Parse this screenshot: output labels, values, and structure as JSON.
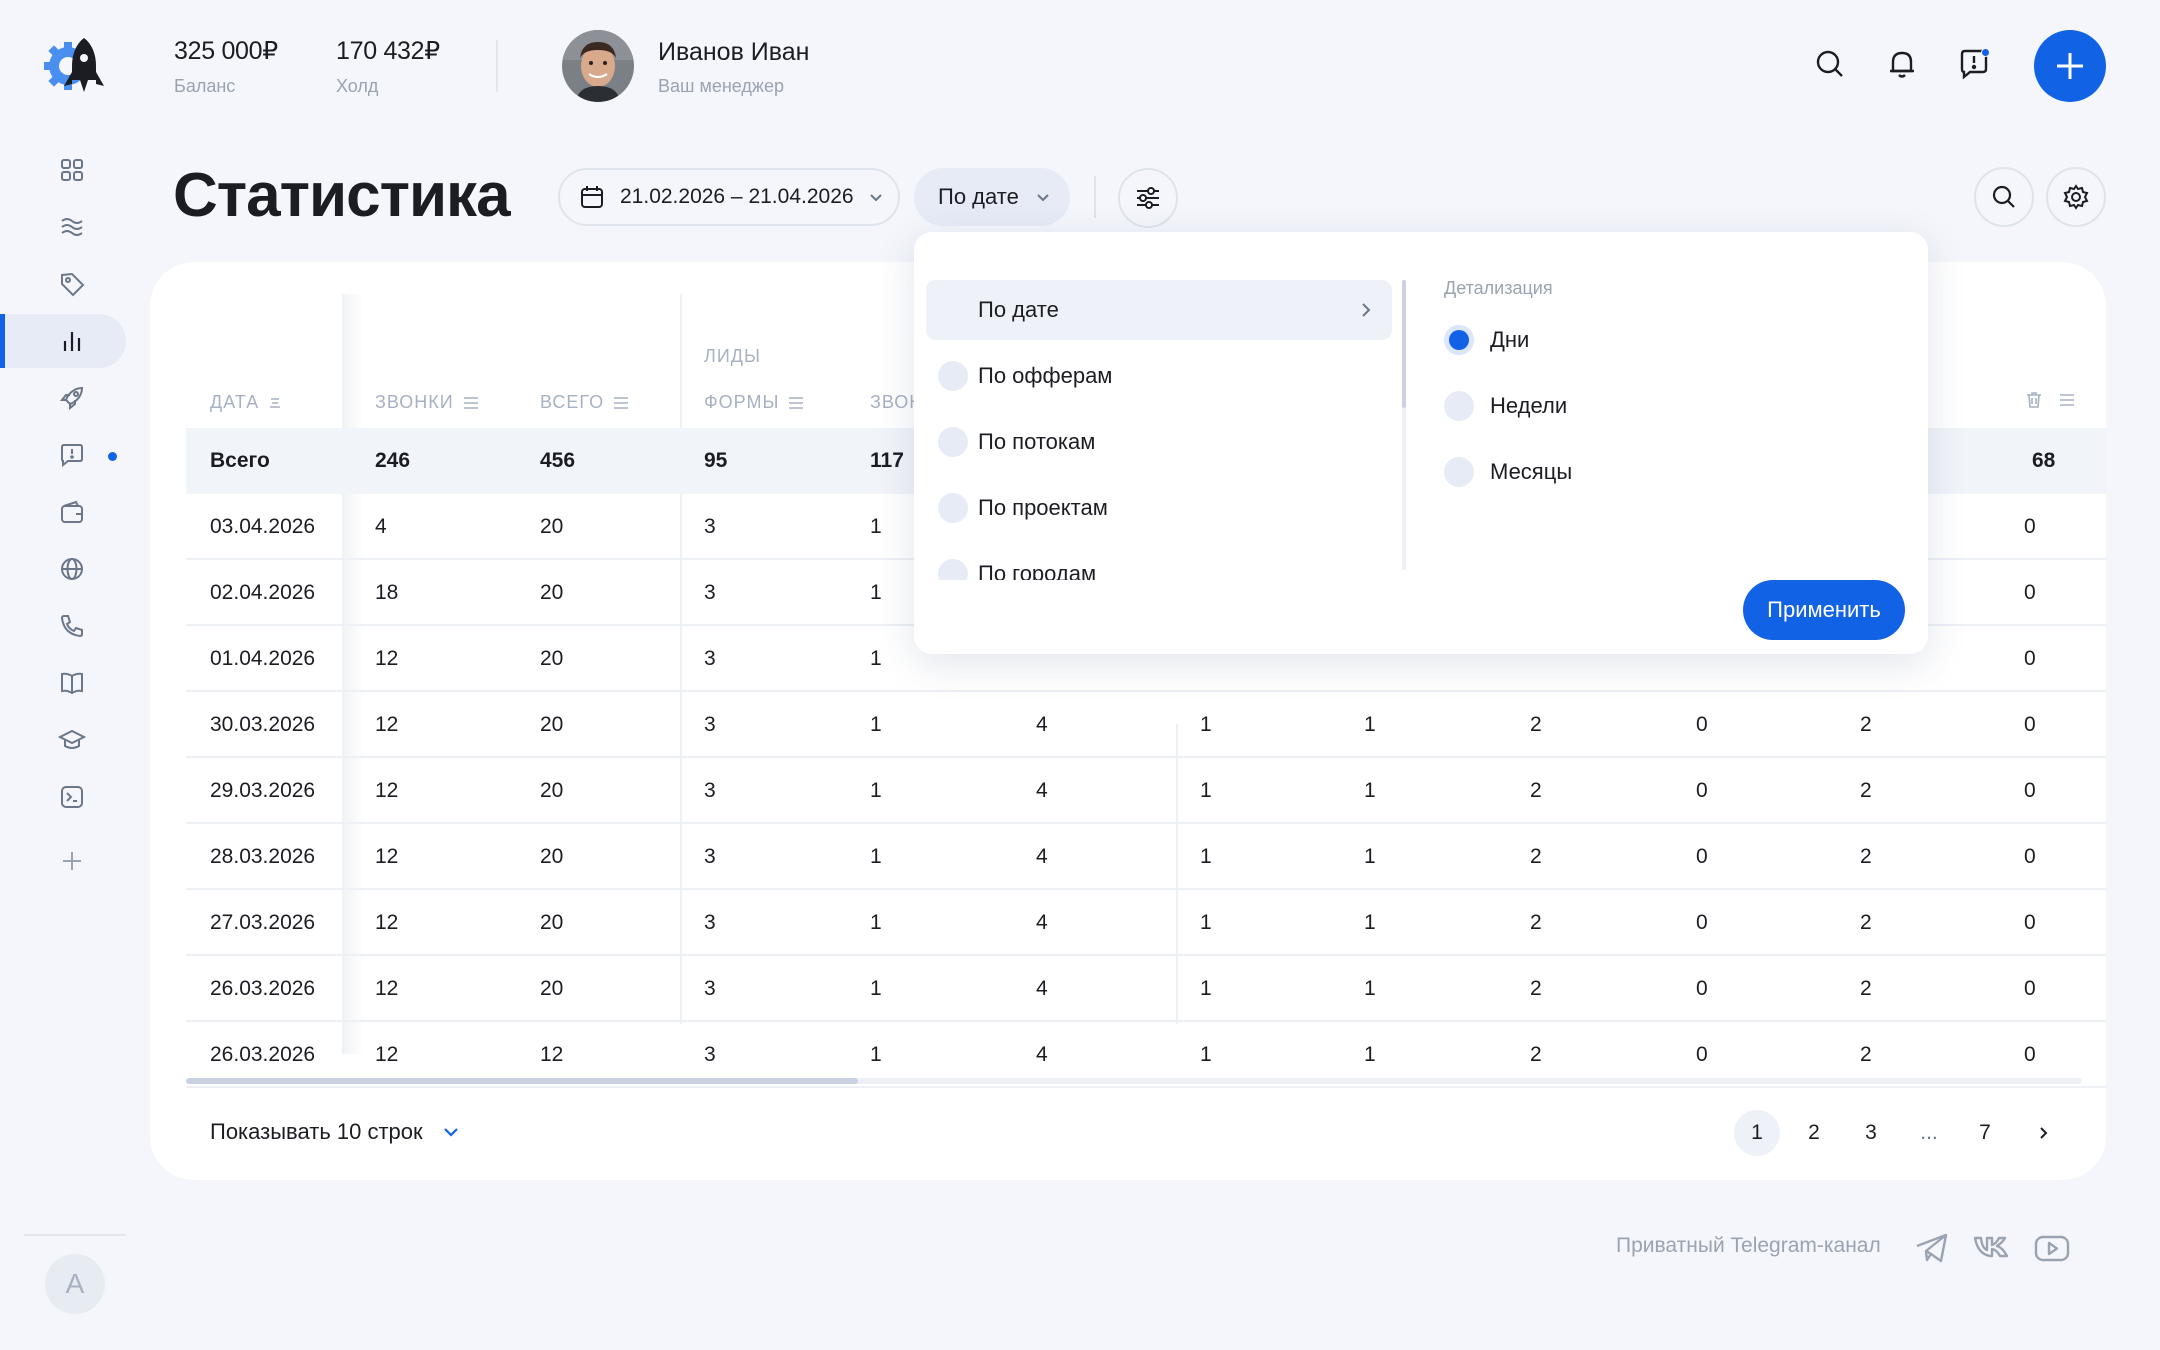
{
  "top": {
    "balances": [
      {
        "value": "325 000₽",
        "label": "Баланс"
      },
      {
        "value": "170 432₽",
        "label": "Холд"
      }
    ],
    "manager": {
      "name": "Иванов Иван",
      "role": "Ваш менеджер"
    }
  },
  "sidebar": {
    "items": [
      "grid-icon",
      "waves-icon",
      "tag-icon",
      "chart-icon",
      "rocket-icon",
      "chat-alert-icon",
      "wallet-icon",
      "globe-icon",
      "phone-icon",
      "book-icon",
      "graduation-icon",
      "terminal-icon",
      "plus-icon"
    ],
    "active": "chart-icon",
    "user_initial": "A"
  },
  "toolbar": {
    "title": "Статистика",
    "date_range": "21.02.2026 – 21.04.2026",
    "group_by": "По дате"
  },
  "table": {
    "group_label": "ЛИДЫ",
    "headers": [
      "ДАТА",
      "ЗВОНКИ",
      "ВСЕГО",
      "ФОРМЫ",
      "ЗВОН"
    ],
    "total": {
      "label": "Всего",
      "values": [
        "246",
        "456",
        "95",
        "117"
      ],
      "last": "68"
    },
    "rows": [
      {
        "date": "03.04.2026",
        "v": [
          "4",
          "20",
          "3",
          "1"
        ],
        "last": "0"
      },
      {
        "date": "02.04.2026",
        "v": [
          "18",
          "20",
          "3",
          "1"
        ],
        "last": "0"
      },
      {
        "date": "01.04.2026",
        "v": [
          "12",
          "20",
          "3",
          "1"
        ],
        "last": "0"
      },
      {
        "date": "30.03.2026",
        "v": [
          "12",
          "20",
          "3",
          "1",
          "4",
          "1",
          "1",
          "2",
          "0",
          "2",
          "0"
        ]
      },
      {
        "date": "29.03.2026",
        "v": [
          "12",
          "20",
          "3",
          "1",
          "4",
          "1",
          "1",
          "2",
          "0",
          "2",
          "0"
        ]
      },
      {
        "date": "28.03.2026",
        "v": [
          "12",
          "20",
          "3",
          "1",
          "4",
          "1",
          "1",
          "2",
          "0",
          "2",
          "0"
        ]
      },
      {
        "date": "27.03.2026",
        "v": [
          "12",
          "20",
          "3",
          "1",
          "4",
          "1",
          "1",
          "2",
          "0",
          "2",
          "0"
        ]
      },
      {
        "date": "26.03.2026",
        "v": [
          "12",
          "20",
          "3",
          "1",
          "4",
          "1",
          "1",
          "2",
          "0",
          "2",
          "0"
        ]
      },
      {
        "date": "26.03.2026",
        "v": [
          "12",
          "12",
          "3",
          "1",
          "4",
          "1",
          "1",
          "2",
          "0",
          "2",
          "0"
        ]
      }
    ],
    "rows_per_page": "Показывать 10 строк",
    "pages": [
      "1",
      "2",
      "3",
      "...",
      "7"
    ],
    "current_page": "1"
  },
  "popover": {
    "groups": [
      "По дате",
      "По офферам",
      "По потокам",
      "По проектам",
      "По городам"
    ],
    "selected_group": "По дате",
    "detail_title": "Детализация",
    "details": [
      "Дни",
      "Недели",
      "Месяцы"
    ],
    "selected_detail": "Дни",
    "apply": "Применить"
  },
  "footer": {
    "text": "Приватный Telegram-канал",
    "icons": [
      "telegram-icon",
      "vk-icon",
      "youtube-icon"
    ]
  },
  "colors": {
    "accent": "#1262e6",
    "background": "#f4f6fb"
  }
}
